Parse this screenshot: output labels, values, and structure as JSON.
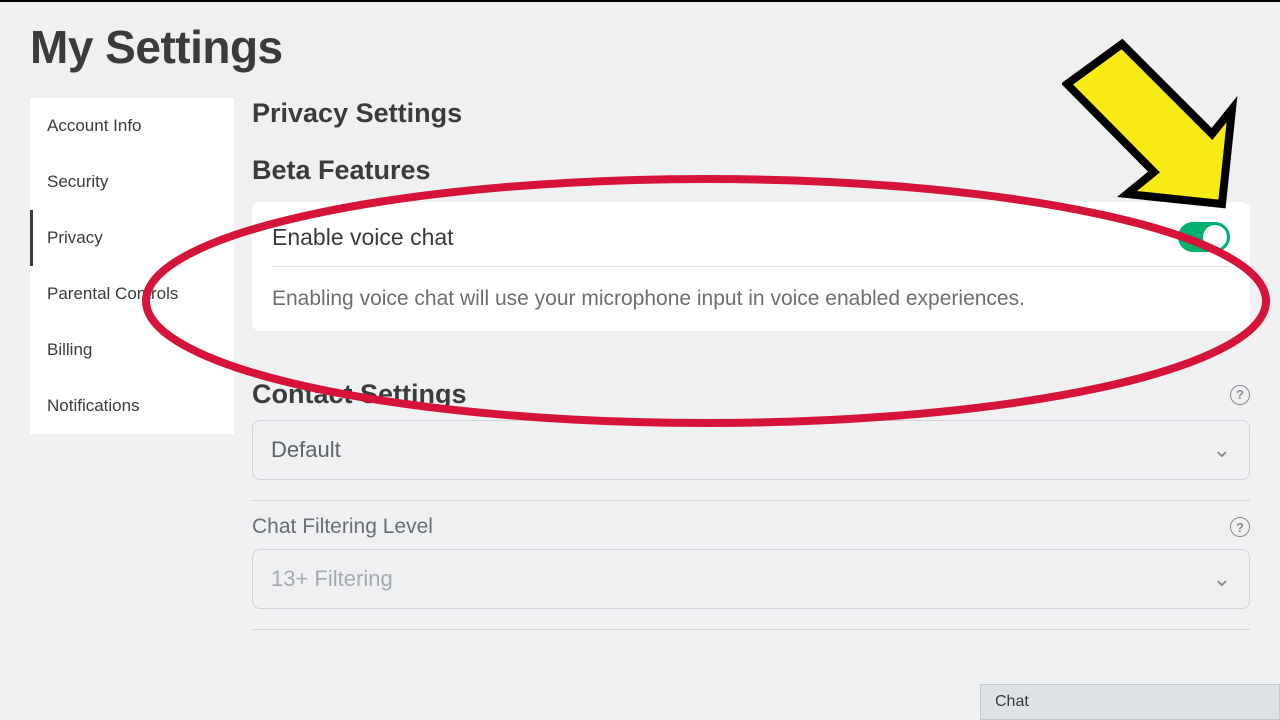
{
  "page_title": "My Settings",
  "sidebar": {
    "items": [
      {
        "label": "Account Info",
        "active": false
      },
      {
        "label": "Security",
        "active": false
      },
      {
        "label": "Privacy",
        "active": true
      },
      {
        "label": "Parental Controls",
        "active": false
      },
      {
        "label": "Billing",
        "active": false
      },
      {
        "label": "Notifications",
        "active": false
      }
    ]
  },
  "main": {
    "privacy_heading": "Privacy Settings",
    "beta_heading": "Beta Features",
    "voice_toggle": {
      "label": "Enable voice chat",
      "enabled": true,
      "description": "Enabling voice chat will use your microphone input in voice enabled experiences."
    },
    "contact_heading": "Contact Settings",
    "contact_select": {
      "value": "Default"
    },
    "filter_label": "Chat Filtering Level",
    "filter_select": {
      "value": "13+ Filtering"
    }
  },
  "chat_bar": {
    "label": "Chat"
  },
  "icons": {
    "help": "?",
    "chevron_down": "⌄"
  },
  "colors": {
    "toggle_on": "#00b06f",
    "annotation_red": "#d6143a",
    "arrow_fill": "#f8ea13"
  }
}
